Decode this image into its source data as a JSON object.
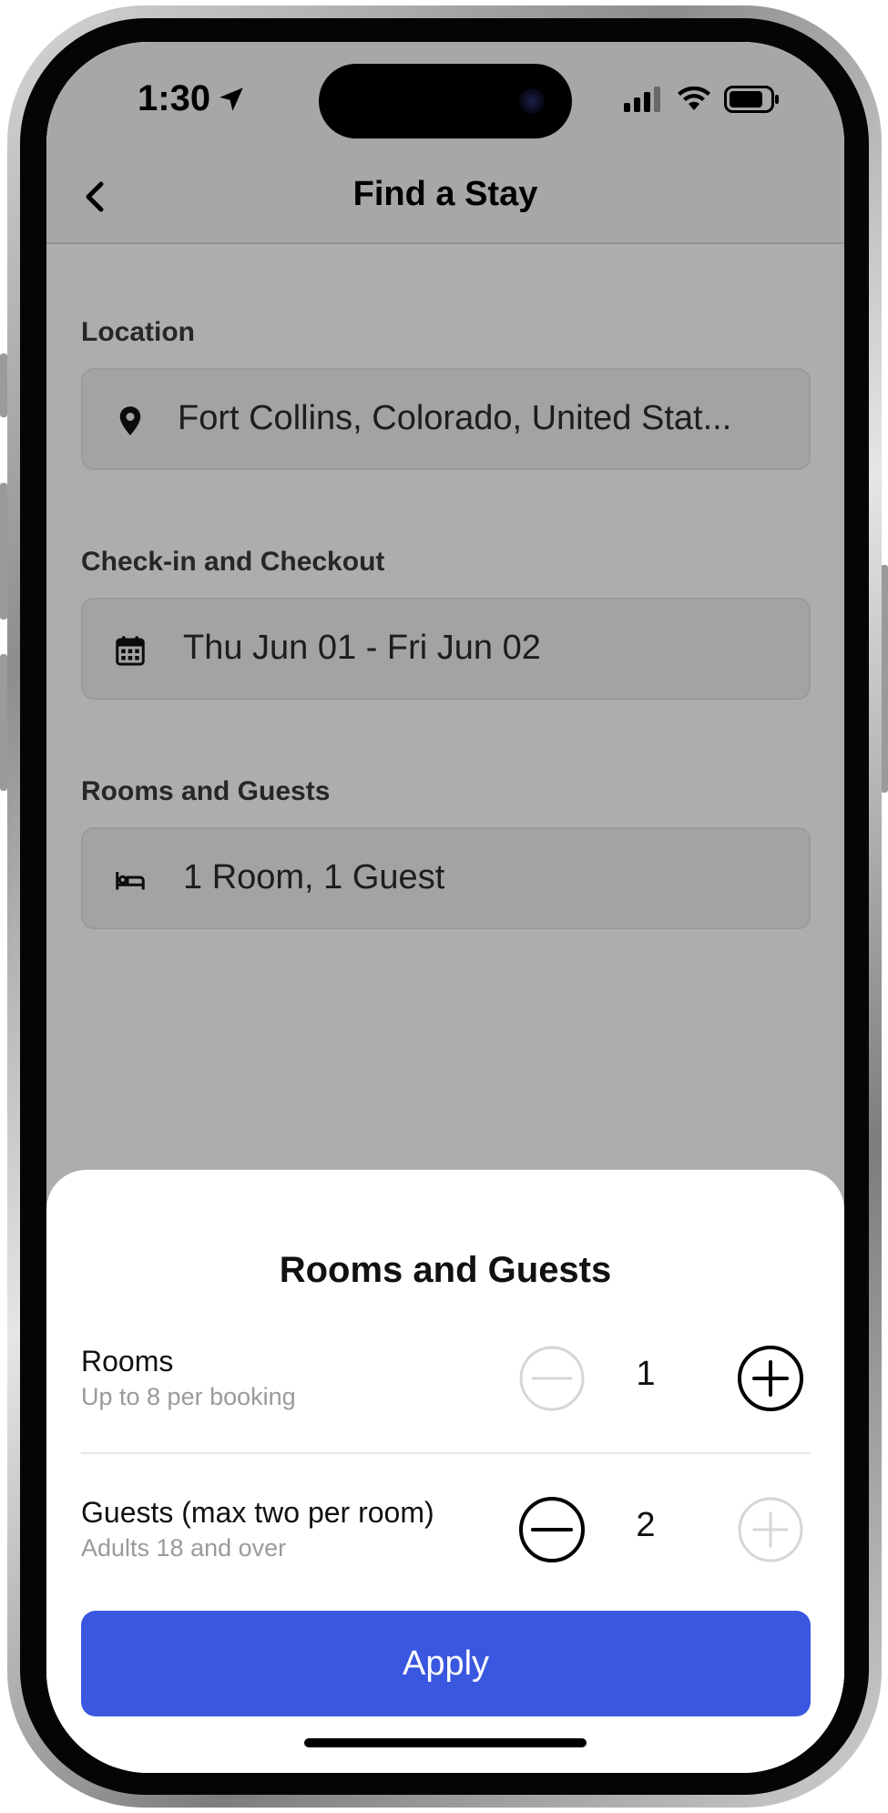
{
  "status_bar": {
    "time": "1:30"
  },
  "header": {
    "title": "Find a Stay"
  },
  "form": {
    "location": {
      "label": "Location",
      "value": "Fort Collins, Colorado, United Stat..."
    },
    "dates": {
      "label": "Check-in and Checkout",
      "value": "Thu Jun 01 - Fri Jun 02"
    },
    "rooms_guests": {
      "label": "Rooms and Guests",
      "value": "1 Room, 1 Guest"
    }
  },
  "sheet": {
    "title": "Rooms and Guests",
    "rooms": {
      "title": "Rooms",
      "subtitle": "Up to 8 per booking",
      "value": "1",
      "decrement_enabled": false,
      "increment_enabled": true
    },
    "guests": {
      "title": "Guests (max two per room)",
      "subtitle": "Adults 18 and over",
      "value": "2",
      "decrement_enabled": true,
      "increment_enabled": false
    },
    "apply_label": "Apply"
  },
  "colors": {
    "accent": "#3a57e0",
    "disabled": "#d6d6d6"
  },
  "icons": {
    "back": "chevron-left-icon",
    "location": "map-pin-icon",
    "dates": "calendar-icon",
    "rooms": "bed-icon",
    "decrement": "minus-circle-icon",
    "increment": "plus-circle-icon"
  }
}
